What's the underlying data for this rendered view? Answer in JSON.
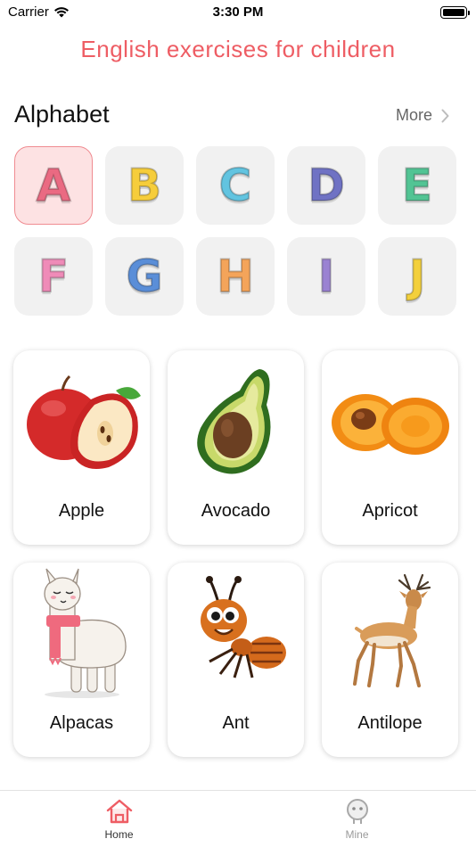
{
  "status_bar": {
    "carrier": "Carrier",
    "time": "3:30 PM"
  },
  "app_title": "English exercises for children",
  "alphabet": {
    "title": "Alphabet",
    "more_label": "More",
    "letters": [
      {
        "char": "A",
        "color": "#ea6a82",
        "selected": true
      },
      {
        "char": "B",
        "color": "#f6cd3b",
        "selected": false
      },
      {
        "char": "C",
        "color": "#62c4e0",
        "selected": false
      },
      {
        "char": "D",
        "color": "#6f72c4",
        "selected": false
      },
      {
        "char": "E",
        "color": "#52c494",
        "selected": false
      },
      {
        "char": "F",
        "color": "#ef8bb8",
        "selected": false
      },
      {
        "char": "G",
        "color": "#5a8ed8",
        "selected": false
      },
      {
        "char": "H",
        "color": "#f4a45a",
        "selected": false
      },
      {
        "char": "I",
        "color": "#9a82d2",
        "selected": false
      },
      {
        "char": "J",
        "color": "#f3d03c",
        "selected": false
      }
    ]
  },
  "words": [
    {
      "label": "Apple",
      "icon": "apple-image"
    },
    {
      "label": "Avocado",
      "icon": "avocado-image"
    },
    {
      "label": "Apricot",
      "icon": "apricot-image"
    },
    {
      "label": "Alpacas",
      "icon": "alpaca-image"
    },
    {
      "label": "Ant",
      "icon": "ant-image"
    },
    {
      "label": "Antilope",
      "icon": "antelope-image"
    }
  ],
  "tab_bar": {
    "tabs": [
      {
        "label": "Home",
        "icon": "home-icon",
        "active": true,
        "color": "#ee5d64"
      },
      {
        "label": "Mine",
        "icon": "user-icon",
        "active": false,
        "color": "#a8a8a8"
      }
    ]
  }
}
